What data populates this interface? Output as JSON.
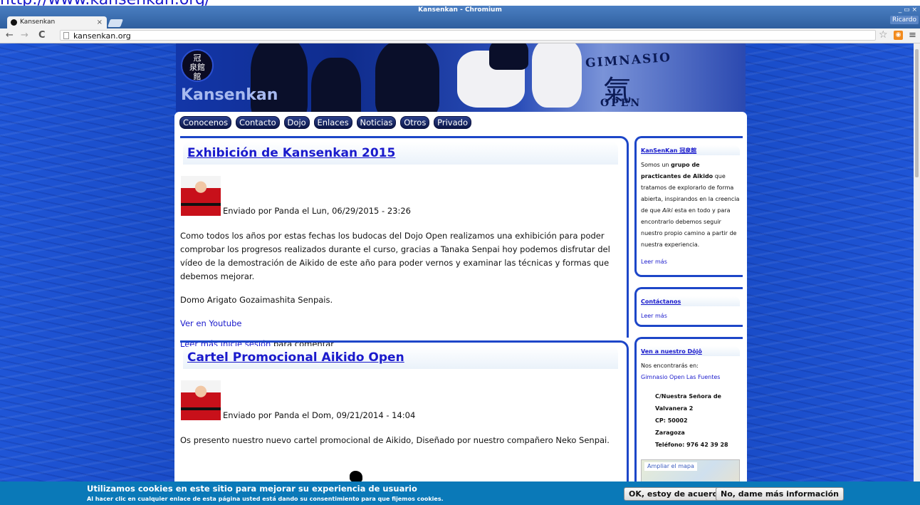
{
  "top_link": {
    "text": "http://www.kansenkan.org/"
  },
  "window": {
    "title": "Kansenkan - Chromium",
    "controls": "_ ▭ ×",
    "user": "Ricardo"
  },
  "tab": {
    "title": "Kansenkan",
    "close": "×"
  },
  "toolbar": {
    "back": "←",
    "forward": "→",
    "reload": "C",
    "url": "kansenkan.org",
    "star": "☆",
    "menu": "≡"
  },
  "site": {
    "logo_text": "冠\n泉館\n館",
    "name": "Kansenkan",
    "banner_gym": "GIMNASIO",
    "banner_ki": "氣",
    "banner_open": "OPEN"
  },
  "nav": [
    "Conocenos",
    "Contacto",
    "Dojo",
    "Enlaces",
    "Noticias",
    "Otros",
    "Privado"
  ],
  "posts": [
    {
      "title": "Exhibición de Kansenkan 2015",
      "byline": "Enviado por Panda el Lun, 06/29/2015 - 23:26",
      "body": [
        "Como todos los años por estas fechas los budocas del Dojo Open realizamos una exhibición para poder comprobar los progresos realizados durante el curso, gracias a Tanaka Senpai hoy podemos disfrutar del vídeo de la demostración de Aikido de este año para poder vernos y examinar las técnicas y formas que debemos mejorar.",
        "Domo Arigato Gozaimashita Senpais."
      ],
      "video_link": "Ver en Youtube",
      "read_more": "Leer más",
      "login": "Inicie sesión",
      "comment_suffix": "para comentar"
    },
    {
      "title": "Cartel Promocional Aikido Open",
      "byline": "Enviado por Panda el Dom, 09/21/2014 - 14:04",
      "body": [
        "Os presento nuestro nuevo cartel promocional de Aikido, Diseñado por nuestro compañero Neko Senpai."
      ]
    }
  ],
  "sidebar": {
    "about": {
      "title": "KanSenKan 冠泉館",
      "text_1": "Somos un ",
      "bold": "grupo de practicantes de Aikido",
      "text_2": " que tratamos de explorarlo de forma abierta, inspirandos en la creencia de que ",
      "italic": "Aiki",
      "text_3": " esta en todo y para encontrarlo debemos seguir nuestro propio camino a partir de nuestra experiencia.",
      "read_more": "Leer más"
    },
    "contact": {
      "title": "Contáctanos",
      "read_more": "Leer más"
    },
    "dojo": {
      "title": "Ven a nuestro Dôjô",
      "intro": "Nos encontrarás en:",
      "link": "Gimnasio Open Las Fuentes",
      "address": [
        "C/Nuestra Señora de",
        "Valvanera 2",
        "CP: 50002",
        "Zaragoza",
        "Teléfono: 976 42 39 28"
      ],
      "map_link": "Ampliar el mapa"
    }
  },
  "cookie": {
    "title": "Utilizamos cookies en este sitio para mejorar su experiencia de usuario",
    "subtitle": "Al hacer clic en cualquier enlace de esta página usted está dando su consentimiento para que fijemos cookies.",
    "accept": "OK, estoy de acuerdo",
    "decline": "No, dame más información"
  },
  "colors": {
    "accent_blue": "#1d46c8",
    "link": "#1a1acc",
    "cookie_bar": "#0a79b8",
    "nav_pill": "#0b1647"
  }
}
